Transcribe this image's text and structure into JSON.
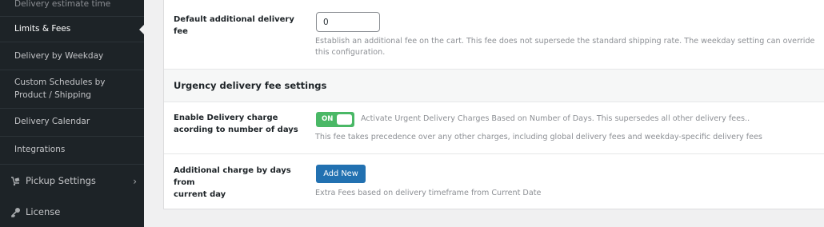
{
  "sidebar": {
    "items": [
      {
        "label": "Delivery estimate time"
      },
      {
        "label": "Limits & Fees"
      },
      {
        "label": "Delivery by Weekday"
      },
      {
        "label": "Custom Schedules by Product / Shipping"
      },
      {
        "label": "Delivery Calendar"
      },
      {
        "label": "Integrations"
      }
    ],
    "pickup": {
      "label": "Pickup Settings",
      "icon": "pickup-icon"
    },
    "license": {
      "label": "License",
      "icon": "key-icon"
    }
  },
  "settings": {
    "default_fee": {
      "label": "Default additional delivery fee",
      "value": "0",
      "desc_line1": "Establish an additional fee on the cart. This fee does not supersede the standard shipping rate. The weekday setting can override",
      "desc_line2": "this configuration."
    },
    "urgency_section": {
      "title": "Urgency delivery fee settings"
    },
    "enable_charge": {
      "label_line1": "Enable Delivery charge",
      "label_line2": "acording to number of days",
      "toggle_label": "ON",
      "toggle_text": "Activate Urgent Delivery Charges Based on Number of Days. This supersedes all other delivery fees..",
      "desc": "This fee takes precedence over any other charges, including global delivery fees and weekday-specific delivery fees"
    },
    "additional_charge": {
      "label_line1": "Additional charge by days from",
      "label_line2": "current day",
      "button_label": "Add New",
      "desc": "Extra Fees based on delivery timeframe from Current Date"
    }
  },
  "colors": {
    "sidebar_bg": "#1d2327",
    "toggle_on": "#4ab866",
    "button_blue": "#2271b1"
  }
}
